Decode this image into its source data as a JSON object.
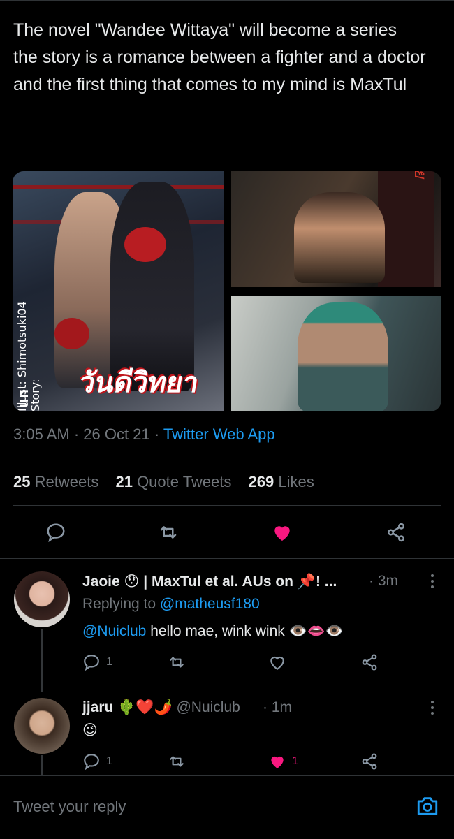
{
  "tweet": {
    "text": "The novel \"Wandee Wittaya\" will become a series\n the story is a romance between a fighter and a doctor and the first thing that comes to my mind is MaxTul",
    "media": {
      "cover_title": "วันดีวิทยา",
      "cover_credit": "Illust: Shimotsuki04   Story: ",
      "cover_logo": "un",
      "bag_text": "ไทย"
    },
    "time": "3:05 AM",
    "date": "26 Oct 21",
    "source": "Twitter Web App",
    "stats": {
      "retweets_count": "25",
      "retweets_label": "Retweets",
      "quotes_count": "21",
      "quotes_label": "Quote Tweets",
      "likes_count": "269",
      "likes_label": "Likes"
    },
    "actions": {
      "like_color": "#f91880"
    }
  },
  "replies": [
    {
      "name": "Jaoie 😯 | MaxTul et al. AUs on 📌! ...",
      "time": "· 3m",
      "replying_prefix": "Replying to ",
      "replying_handle": "@matheusf180",
      "mention": "@Nuiclub",
      "text": " hello mae, wink wink 👁️👄👁️",
      "reply_count": "1",
      "like_count": "",
      "liked": false
    },
    {
      "name": "jjaru 🌵❤️🌶️",
      "handle": "@Nuiclub",
      "time": "· 1m",
      "text": "😉",
      "reply_count": "1",
      "like_count": "1",
      "liked": true
    }
  ],
  "compose": {
    "placeholder": "Tweet your reply"
  },
  "colors": {
    "accent": "#1d9bf0",
    "like": "#f91880",
    "muted": "#71767b",
    "border": "#2f3336"
  }
}
